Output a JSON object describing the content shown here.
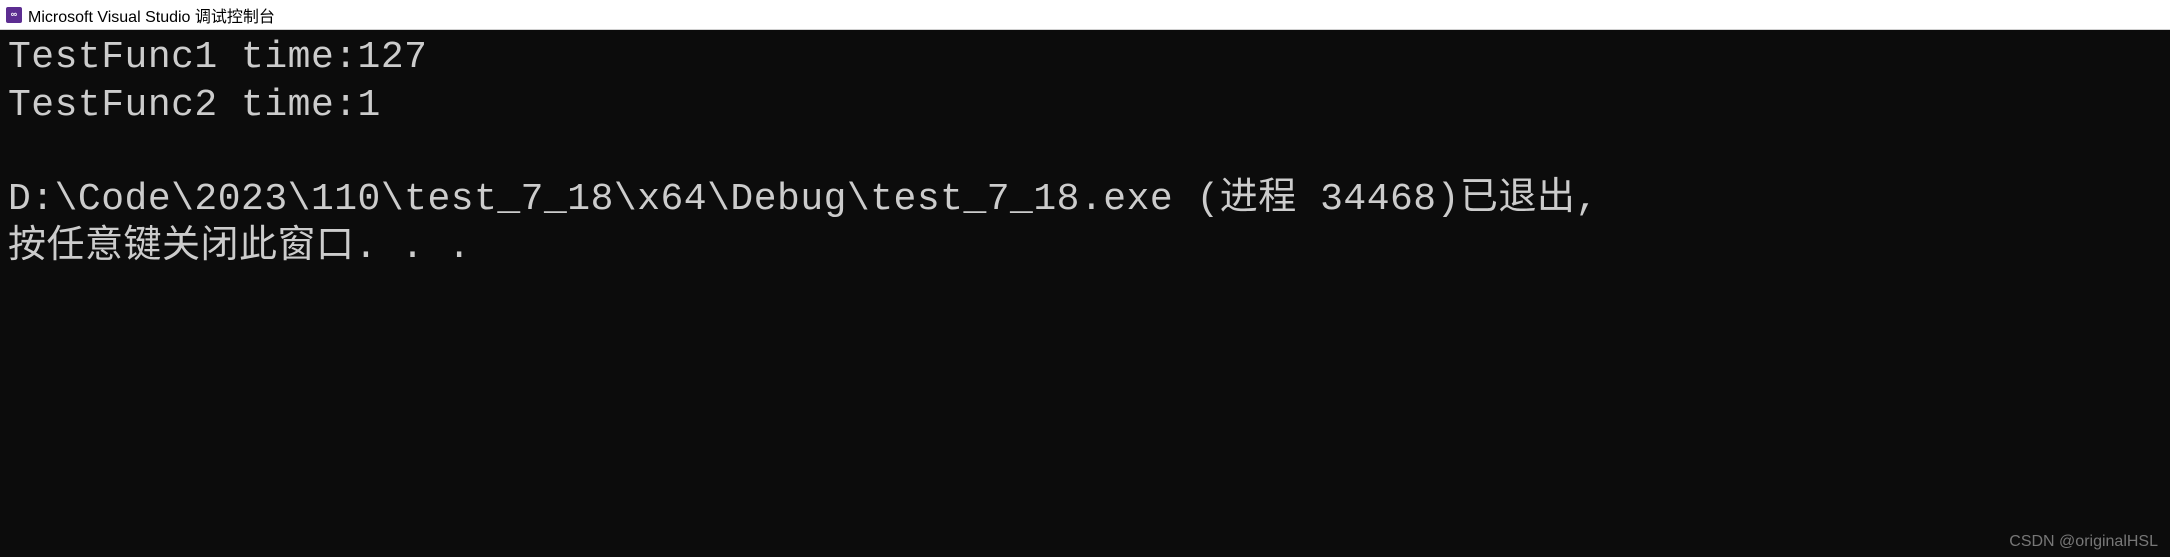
{
  "titlebar": {
    "icon_label": "vs-icon",
    "icon_text": "⧉",
    "title": "Microsoft Visual Studio 调试控制台"
  },
  "console": {
    "lines": [
      "TestFunc1 time:127",
      "TestFunc2 time:1",
      "",
      "D:\\Code\\2023\\110\\test_7_18\\x64\\Debug\\test_7_18.exe (进程 34468)已退出,",
      "按任意键关闭此窗口. . ."
    ]
  },
  "watermark": {
    "text": "CSDN @originalHSL"
  }
}
